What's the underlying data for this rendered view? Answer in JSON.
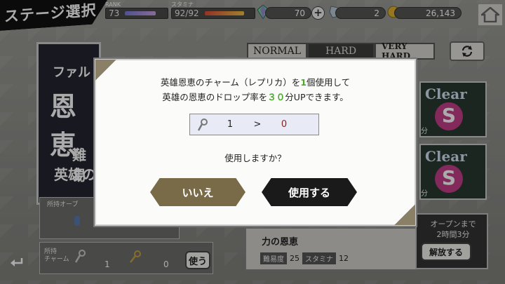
{
  "header": {
    "title": "ステージ選択",
    "rank_label": "RANK",
    "rank_value": "73",
    "stamina_label": "スタミナ",
    "stamina_value": "92/92",
    "crystal_value": "70",
    "plus_label": "+",
    "ticket_value": "2",
    "gold_value": "26,143"
  },
  "tabs": [
    "NORMAL",
    "HARD",
    "VERY HARD"
  ],
  "active_tab": "HARD",
  "left_panel": {
    "line1": "ファル",
    "line2": "恩恵",
    "line3": "難易",
    "line4": "英雄の"
  },
  "orb_panel": {
    "label": "所持オーブ"
  },
  "charm_panel": {
    "label_line1": "所持",
    "label_line2": "チャーム",
    "charm1_count": "1",
    "charm2_count": "0",
    "use_label": "使う"
  },
  "stage_cards": [
    {
      "clear_label": "Clear",
      "rank_badge": "S",
      "suffix": "分"
    },
    {
      "clear_label": "Clear",
      "rank_badge": "S",
      "suffix": "分"
    }
  ],
  "bottom_stage": {
    "name": "力の恩恵",
    "difficulty_label": "難易度",
    "difficulty_value": "25",
    "stamina_label": "スタミナ",
    "stamina_value": "12"
  },
  "open_box": {
    "line1": "オープンまで",
    "line2": "2時間3分",
    "release_label": "解放する"
  },
  "dialog": {
    "msg_line1_a": "英雄恩恵のチャーム（レプリカ）を",
    "msg_line1_num": "1",
    "msg_line1_b": "個使用して",
    "msg_line2_a": "英雄の恩恵のドロップ率を",
    "msg_line2_num": "３０",
    "msg_line2_b": "分UPできます。",
    "count_from": "1",
    "count_arrow": ">",
    "count_to": "0",
    "question": "使用しますか？",
    "no_label": "いいえ",
    "yes_label": "使用する"
  },
  "colors": {
    "highlight_green": "#4aa82a",
    "no_button": "#7a6b48",
    "yes_button": "#1a1a1a",
    "count_to": "#8a1e1e"
  }
}
